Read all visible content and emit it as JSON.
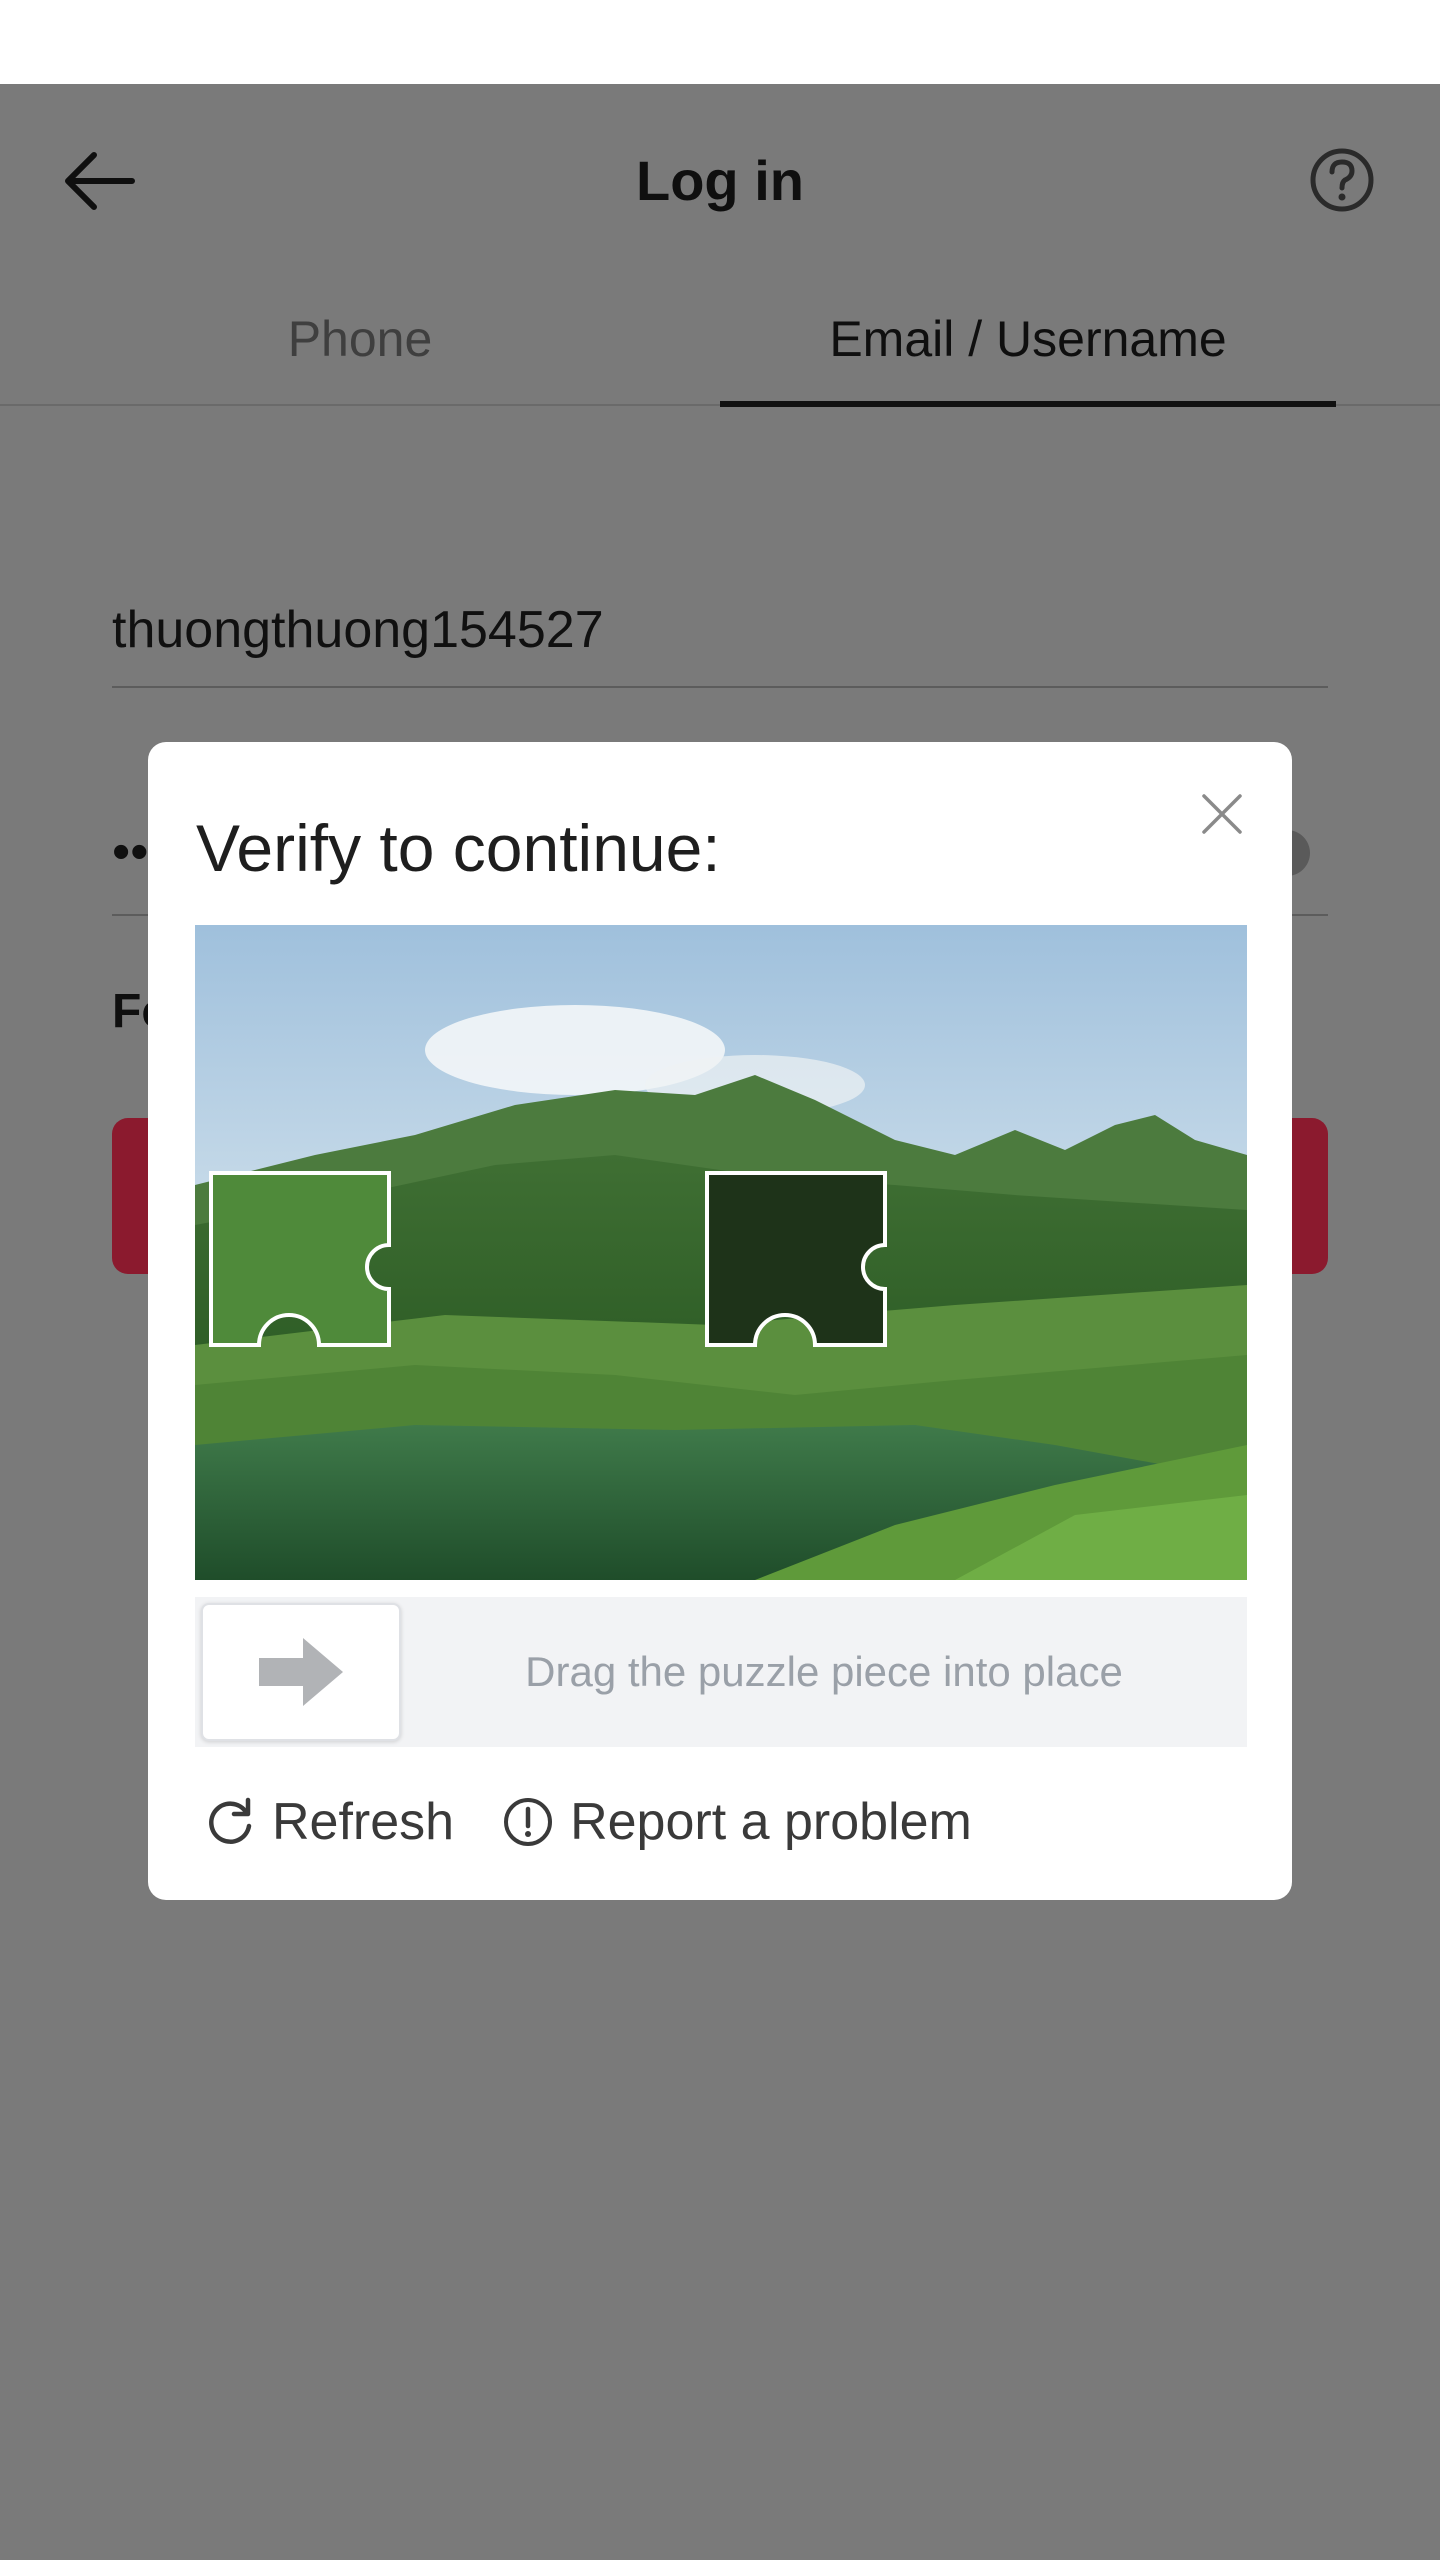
{
  "header": {
    "title": "Log in",
    "back_icon": "arrow-left-icon",
    "help_icon": "question-circle-icon"
  },
  "tabs": [
    {
      "label": "Phone",
      "active": false
    },
    {
      "label": "Email / Username",
      "active": true
    }
  ],
  "form": {
    "username_value": "thuongthuong154527",
    "password_value": "••",
    "forgot_label": "Fo"
  },
  "captcha": {
    "title": "Verify to continue:",
    "slider_hint": "Drag the puzzle piece into place",
    "refresh_label": "Refresh",
    "report_label": "Report a problem",
    "close_icon": "close-icon",
    "handle_icon": "arrow-right-icon"
  },
  "colors": {
    "overlay_bg": "#7a7a7a",
    "login_button": "#8b1a2e",
    "modal_bg": "#ffffff",
    "slider_track": "#f2f3f5"
  }
}
